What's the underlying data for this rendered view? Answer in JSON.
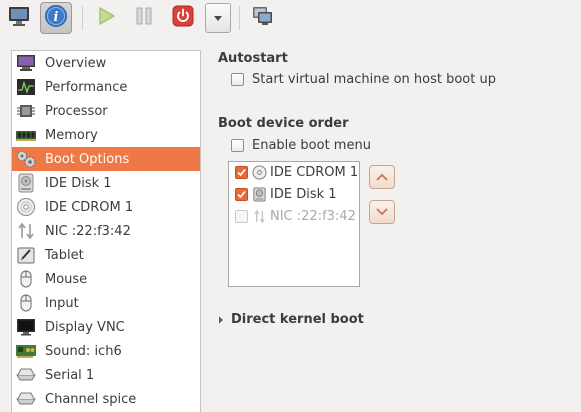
{
  "toolbar": {
    "buttons": [
      {
        "name": "console",
        "icon": "monitor-icon"
      },
      {
        "name": "details",
        "icon": "info-icon",
        "active": true
      },
      {
        "name": "run",
        "icon": "play-icon"
      },
      {
        "name": "pause",
        "icon": "pause-icon"
      },
      {
        "name": "shutdown",
        "icon": "power-icon"
      },
      {
        "name": "shutdown-menu",
        "icon": "chevron-down-icon"
      },
      {
        "name": "snapshots",
        "icon": "snapshot-icon"
      }
    ]
  },
  "sidebar": {
    "items": [
      {
        "label": "Overview",
        "icon": "overview-monitor-icon"
      },
      {
        "label": "Performance",
        "icon": "performance-graph-icon"
      },
      {
        "label": "Processor",
        "icon": "processor-chip-icon"
      },
      {
        "label": "Memory",
        "icon": "memory-module-icon"
      },
      {
        "label": "Boot Options",
        "icon": "boot-gears-icon",
        "selected": true
      },
      {
        "label": "IDE Disk 1",
        "icon": "hard-disk-icon"
      },
      {
        "label": "IDE CDROM 1",
        "icon": "cdrom-icon"
      },
      {
        "label": "NIC :22:f3:42",
        "icon": "network-arrows-icon"
      },
      {
        "label": "Tablet",
        "icon": "tablet-icon"
      },
      {
        "label": "Mouse",
        "icon": "mouse-icon"
      },
      {
        "label": "Input",
        "icon": "input-mouse-icon"
      },
      {
        "label": "Display VNC",
        "icon": "display-icon"
      },
      {
        "label": "Sound: ich6",
        "icon": "sound-card-icon"
      },
      {
        "label": "Serial 1",
        "icon": "serial-port-icon"
      },
      {
        "label": "Channel spice",
        "icon": "channel-icon"
      }
    ]
  },
  "autostart": {
    "title": "Autostart",
    "checkbox_label": "Start virtual machine on host boot up",
    "checked": false
  },
  "boot_order": {
    "title": "Boot device order",
    "menu_label": "Enable boot menu",
    "menu_checked": false,
    "devices": [
      {
        "label": "IDE CDROM 1",
        "checked": true,
        "enabled": true,
        "icon": "cdrom-icon"
      },
      {
        "label": "IDE Disk 1",
        "checked": true,
        "enabled": true,
        "icon": "hard-disk-icon"
      },
      {
        "label": "NIC :22:f3:42",
        "checked": false,
        "enabled": false,
        "icon": "network-arrows-icon"
      }
    ],
    "move_up_icon": "chevron-up-icon",
    "move_down_icon": "chevron-down-icon"
  },
  "kernel": {
    "label": "Direct kernel boot",
    "expanded": false
  },
  "colors": {
    "accent": "#f07746",
    "checkbox_checked": "#e86a3a",
    "run_green": "#a6c36a",
    "power_red": "#d9423c",
    "info_blue": "#3d78c9"
  }
}
